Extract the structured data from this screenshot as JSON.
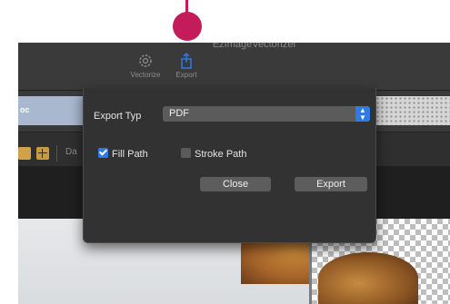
{
  "window": {
    "title": "EzImageVectorizer"
  },
  "toolbar": {
    "vectorize_label": "Vectorize",
    "export_label": "Export",
    "vectorize_icon": "gear-icon",
    "export_icon": "share-icon",
    "accent": "#2f7be6"
  },
  "tab": {
    "label": "oc"
  },
  "tool_row": {
    "label": "Da"
  },
  "dialog": {
    "export_type_label": "Export Typ",
    "export_type_value": "PDF",
    "fill_path_label": "Fill Path",
    "fill_path_checked": true,
    "stroke_path_label": "Stroke Path",
    "stroke_path_checked": false,
    "close_label": "Close",
    "export_label": "Export"
  },
  "marker": {
    "color": "#c41c5a"
  }
}
